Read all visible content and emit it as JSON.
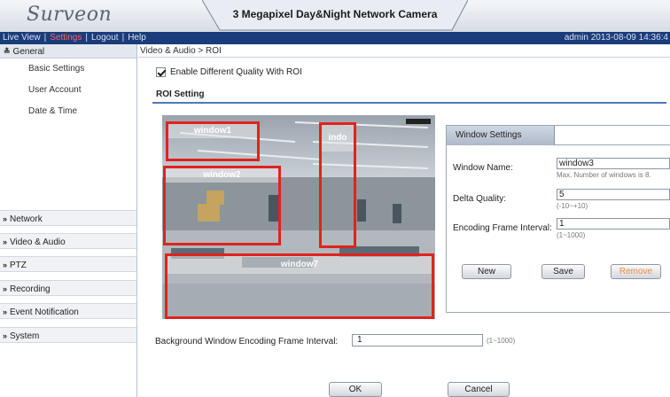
{
  "header": {
    "logo": "Surveon",
    "title": "3 Megapixel Day&Night Network Camera"
  },
  "nav": {
    "live_view": "Live View",
    "settings": "Settings",
    "logout": "Logout",
    "help": "Help",
    "sep": "|",
    "user_info": "admin  2013-08-09 14:36:4"
  },
  "sidebar": {
    "general": "General",
    "sub_items": [
      "Basic Settings",
      "User Account",
      "Date & Time"
    ],
    "sections": [
      "Network",
      "Video & Audio",
      "PTZ",
      "Recording",
      "Event Notification",
      "System"
    ]
  },
  "main": {
    "breadcrumb": "Video & Audio > ROI",
    "enable_roi_label": "Enable Different Quality With ROI",
    "section_title": "ROI Setting",
    "windows": [
      {
        "label": "window1"
      },
      {
        "label": "window2"
      },
      {
        "label": "indo"
      },
      {
        "label": "window7"
      }
    ],
    "window_settings": {
      "tab": "Window Settings",
      "name_label": "Window Name:",
      "name_value": "window3",
      "name_hint": "Max. Number of windows is 8.",
      "delta_label": "Delta Quality:",
      "delta_value": "5",
      "delta_hint": "(-10~+10)",
      "interval_label": "Encoding Frame Interval:",
      "interval_value": "1",
      "interval_hint": "(1~1000)",
      "new_button": "New",
      "save_button": "Save",
      "remove_button": "Remove"
    },
    "background": {
      "label": "Background Window Encoding Frame Interval:",
      "value": "1",
      "hint": "(1~1000)"
    },
    "ok_button": "OK",
    "cancel_button": "Cancel"
  },
  "colors": {
    "nav_bg": "#1b3c7a",
    "roi_border": "#e0231d",
    "section_line": "#4d79b5",
    "remove_text": "#f08a3c"
  }
}
